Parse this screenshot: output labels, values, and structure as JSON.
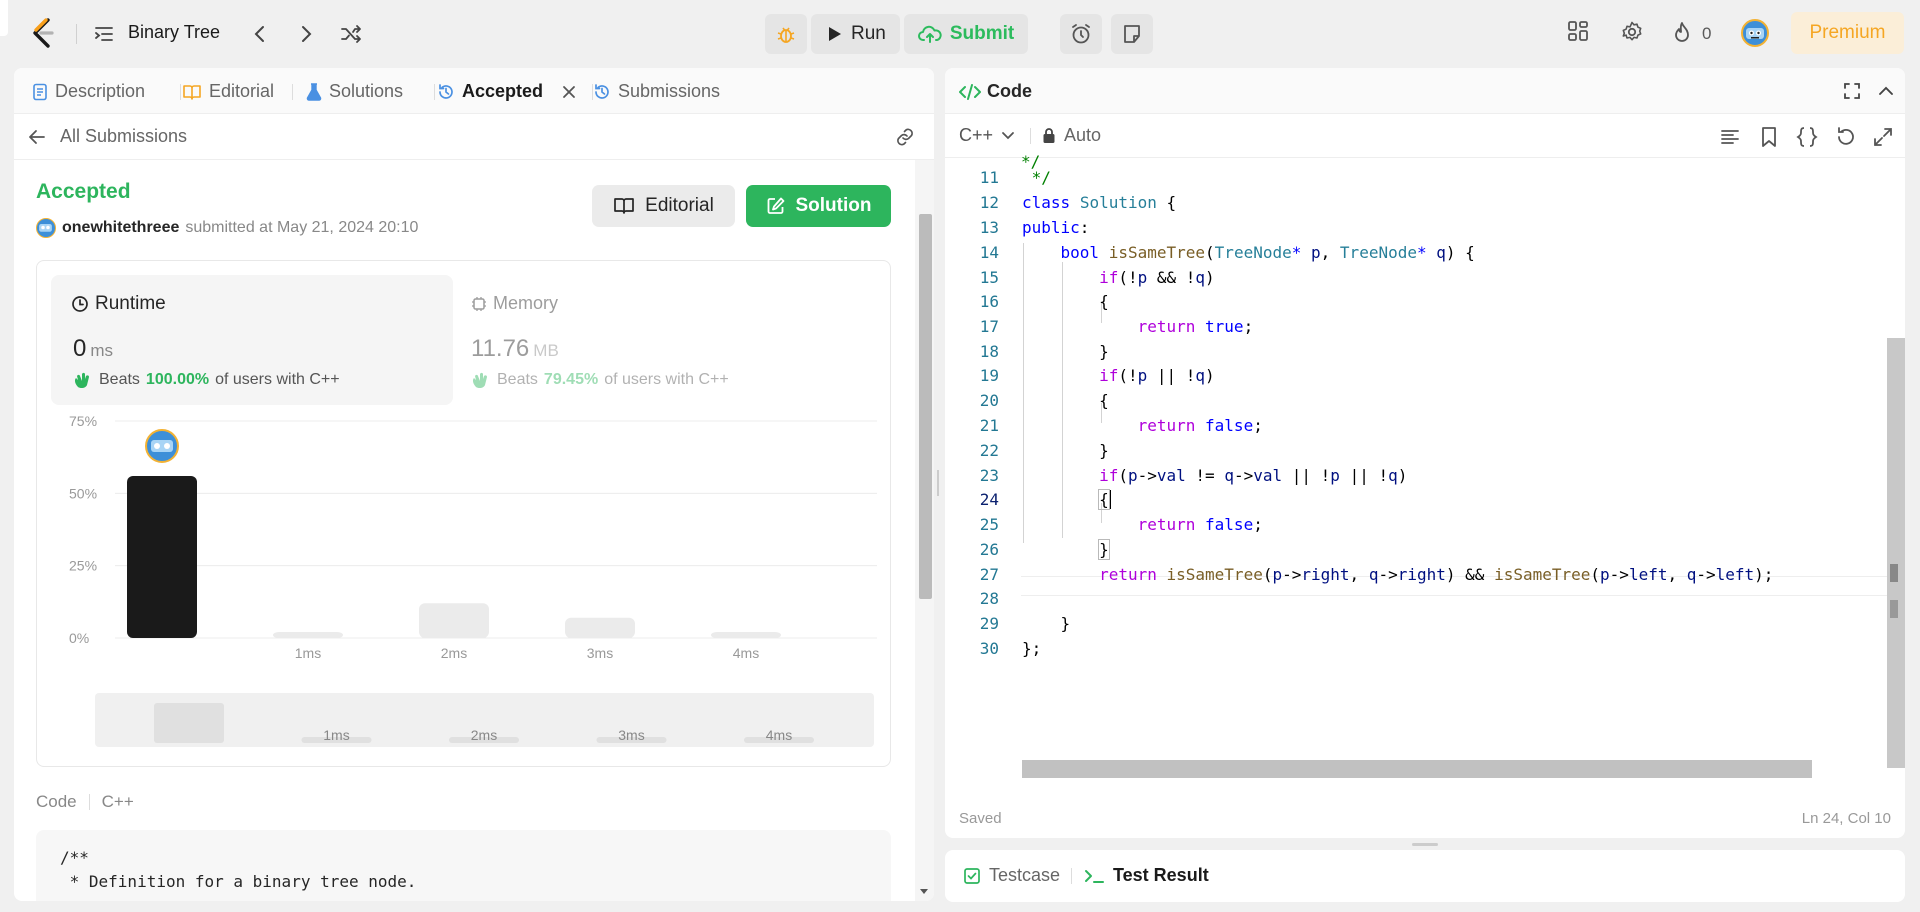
{
  "nav": {
    "problem_list_title": "Binary Tree",
    "run_label": "Run",
    "submit_label": "Submit",
    "streak_count": "0",
    "premium_label": "Premium"
  },
  "left_tabs": [
    {
      "label": "Description"
    },
    {
      "label": "Editorial"
    },
    {
      "label": "Solutions"
    },
    {
      "label": "Accepted"
    },
    {
      "label": "Submissions"
    }
  ],
  "submission": {
    "back_label": "All Submissions",
    "status": "Accepted",
    "username": "onewhitethreee",
    "submitted_text": "submitted at May 21, 2024 20:10",
    "editorial_btn": "Editorial",
    "solution_btn": "Solution"
  },
  "runtime": {
    "label": "Runtime",
    "value": "0",
    "unit": "ms",
    "beats_prefix": "Beats",
    "beats_pct": "100.00%",
    "beats_suffix": "of users with C++"
  },
  "memory": {
    "label": "Memory",
    "value": "11.76",
    "unit": "MB",
    "beats_prefix": "Beats",
    "beats_pct": "79.45%",
    "beats_suffix": "of users with C++"
  },
  "chart_data": {
    "type": "bar",
    "categories": [
      "0ms",
      "1ms",
      "2ms",
      "3ms",
      "4ms"
    ],
    "x_tick_labels": [
      "",
      "1ms",
      "2ms",
      "3ms",
      "4ms"
    ],
    "values": [
      56,
      2,
      12,
      7,
      2
    ],
    "highlight_index": 0,
    "ylim": [
      0,
      75
    ],
    "yticks": [
      "0%",
      "25%",
      "50%",
      "75%"
    ],
    "grid": true,
    "minimap_values": [
      40,
      6,
      6,
      6,
      6
    ],
    "colors": {
      "highlight": "#1a1a1a",
      "other": "#ebebeb",
      "grid": "#ececec"
    }
  },
  "code_preview": {
    "label": "Code",
    "lang": "C++",
    "lines": [
      "/**",
      " * Definition for a binary tree node."
    ]
  },
  "editor": {
    "title": "Code",
    "language": "C++",
    "mode": "Auto",
    "saved": "Saved",
    "cursor": "Ln 24, Col 10",
    "start_line": 11,
    "current_line": 24
  },
  "bottom_tabs": [
    {
      "label": "Testcase"
    },
    {
      "label": "Test Result"
    }
  ],
  "colors": {
    "accent_green": "#2db55d",
    "premium_orange": "#f5a623"
  }
}
